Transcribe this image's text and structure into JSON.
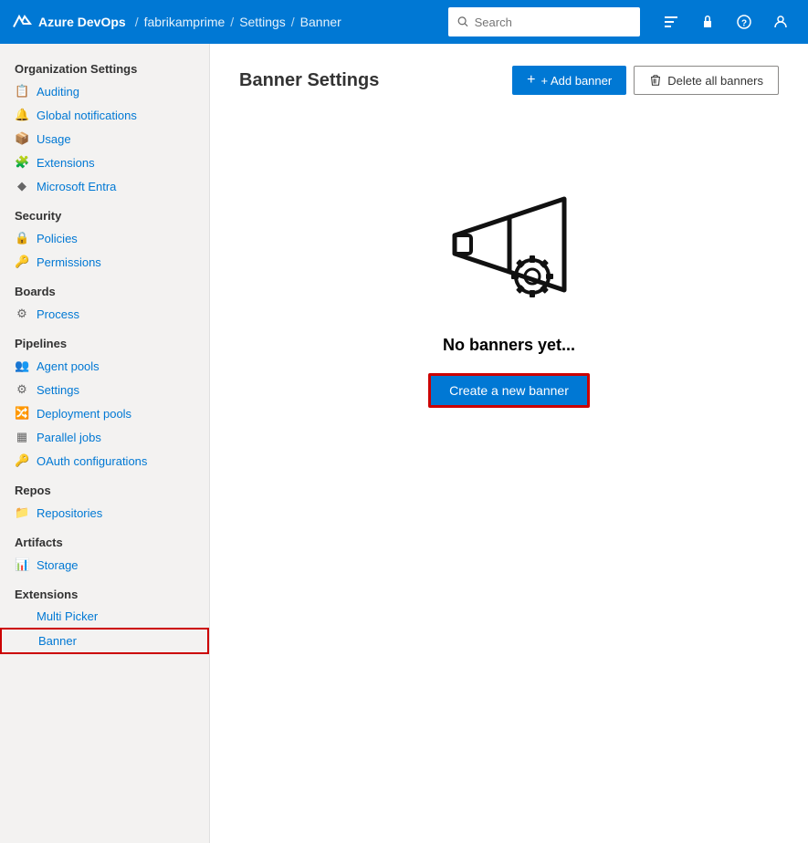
{
  "topbar": {
    "app_name": "Azure DevOps",
    "breadcrumb": [
      {
        "label": "fabrikamprime",
        "url": "#"
      },
      {
        "label": "Settings",
        "url": "#"
      },
      {
        "label": "Banner",
        "url": "#"
      }
    ],
    "search_placeholder": "Search",
    "icons": [
      "list-icon",
      "lock-icon",
      "help-icon",
      "user-icon"
    ]
  },
  "sidebar": {
    "section_org": "Organization Settings",
    "items_overview": [
      {
        "label": "Auditing",
        "icon": "📋"
      },
      {
        "label": "Global notifications",
        "icon": "🔔"
      },
      {
        "label": "Usage",
        "icon": "📦"
      },
      {
        "label": "Extensions",
        "icon": "🧩"
      },
      {
        "label": "Microsoft Entra",
        "icon": "◆"
      }
    ],
    "section_security": "Security",
    "items_security": [
      {
        "label": "Policies",
        "icon": "🔒"
      },
      {
        "label": "Permissions",
        "icon": "🔑"
      }
    ],
    "section_boards": "Boards",
    "items_boards": [
      {
        "label": "Process",
        "icon": "⚙"
      }
    ],
    "section_pipelines": "Pipelines",
    "items_pipelines": [
      {
        "label": "Agent pools",
        "icon": "👥"
      },
      {
        "label": "Settings",
        "icon": "⚙"
      },
      {
        "label": "Deployment pools",
        "icon": "🔀"
      },
      {
        "label": "Parallel jobs",
        "icon": "▦"
      },
      {
        "label": "OAuth configurations",
        "icon": "🔑"
      }
    ],
    "section_repos": "Repos",
    "items_repos": [
      {
        "label": "Repositories",
        "icon": "📁"
      }
    ],
    "section_artifacts": "Artifacts",
    "items_artifacts": [
      {
        "label": "Storage",
        "icon": "📊"
      }
    ],
    "section_extensions": "Extensions",
    "items_extensions": [
      {
        "label": "Multi Picker",
        "icon": ""
      },
      {
        "label": "Banner",
        "icon": "",
        "active": true
      }
    ]
  },
  "main": {
    "title": "Banner Settings",
    "add_banner_label": "+ Add banner",
    "delete_banners_label": "Delete all banners",
    "empty_title": "No banners yet...",
    "create_banner_label": "Create a new banner"
  }
}
